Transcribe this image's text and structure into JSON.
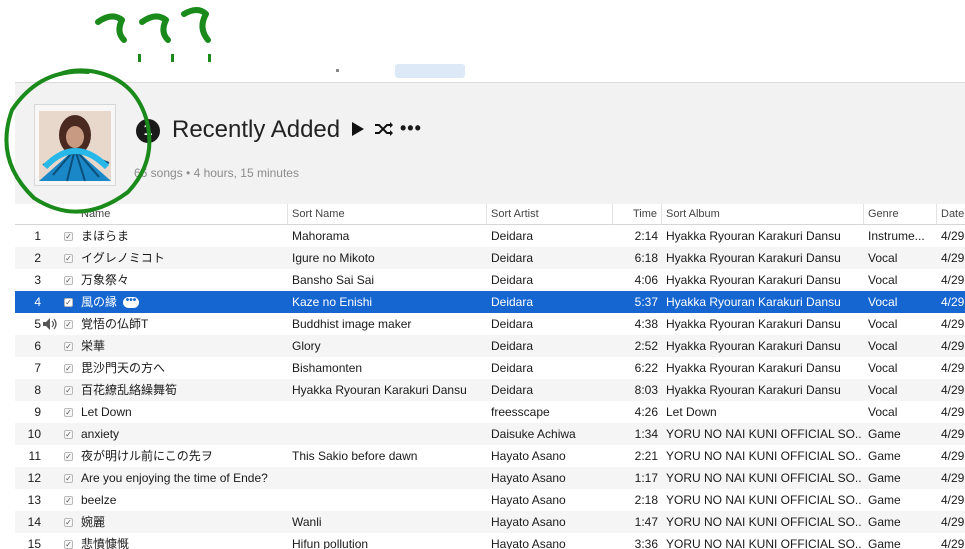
{
  "header": {
    "badge": "1",
    "title": "Recently Added",
    "summary": "66 songs • 4 hours, 15 minutes",
    "more_label": "•••"
  },
  "annotation": {
    "text": "???"
  },
  "columns": {
    "name": "Name",
    "sort_name": "Sort Name",
    "sort_artist": "Sort Artist",
    "time": "Time",
    "sort_album": "Sort Album",
    "genre": "Genre",
    "date": "Date"
  },
  "rows": [
    {
      "num": "1",
      "name": "まほらま",
      "sort_name": "Mahorama",
      "sort_artist": "Deidara",
      "time": "2:14",
      "sort_album": "Hyakka Ryouran Karakuri Dansu",
      "genre": "Instrume...",
      "date": "4/29"
    },
    {
      "num": "2",
      "name": "イグレノミコト",
      "sort_name": "Igure no Mikoto",
      "sort_artist": "Deidara",
      "time": "6:18",
      "sort_album": "Hyakka Ryouran Karakuri Dansu",
      "genre": "Vocal",
      "date": "4/29"
    },
    {
      "num": "3",
      "name": "万象祭々",
      "sort_name": "Bansho Sai Sai",
      "sort_artist": "Deidara",
      "time": "4:06",
      "sort_album": "Hyakka Ryouran Karakuri Dansu",
      "genre": "Vocal",
      "date": "4/29"
    },
    {
      "num": "4",
      "name": "風の縁",
      "sort_name": "Kaze no Enishi",
      "sort_artist": "Deidara",
      "time": "5:37",
      "sort_album": "Hyakka Ryouran Karakuri Dansu",
      "genre": "Vocal",
      "date": "4/29",
      "selected": true
    },
    {
      "num": "5",
      "name": "覚悟の仏師T",
      "sort_name": "Buddhist image maker",
      "sort_artist": "Deidara",
      "time": "4:38",
      "sort_album": "Hyakka Ryouran Karakuri Dansu",
      "genre": "Vocal",
      "date": "4/29",
      "playing": true
    },
    {
      "num": "6",
      "name": "栄華",
      "sort_name": "Glory",
      "sort_artist": "Deidara",
      "time": "2:52",
      "sort_album": "Hyakka Ryouran Karakuri Dansu",
      "genre": "Vocal",
      "date": "4/29"
    },
    {
      "num": "7",
      "name": "毘沙門天の方へ",
      "sort_name": "Bishamonten",
      "sort_artist": "Deidara",
      "time": "6:22",
      "sort_album": "Hyakka Ryouran Karakuri Dansu",
      "genre": "Vocal",
      "date": "4/29"
    },
    {
      "num": "8",
      "name": "百花繚乱絡繰舞筍",
      "sort_name": "Hyakka Ryouran Karakuri Dansu",
      "sort_artist": "Deidara",
      "time": "8:03",
      "sort_album": "Hyakka Ryouran Karakuri Dansu",
      "genre": "Vocal",
      "date": "4/29"
    },
    {
      "num": "9",
      "name": "Let Down",
      "sort_name": "",
      "sort_artist": "freesscape",
      "time": "4:26",
      "sort_album": "Let Down",
      "genre": "Vocal",
      "date": "4/29"
    },
    {
      "num": "10",
      "name": "anxiety",
      "sort_name": "",
      "sort_artist": "Daisuke Achiwa",
      "time": "1:34",
      "sort_album": "YORU NO NAI KUNI OFFICIAL SO...",
      "genre": "Game",
      "date": "4/29"
    },
    {
      "num": "11",
      "name": "夜が明けル前にこの先ヲ",
      "sort_name": "This Sakio before dawn",
      "sort_artist": "Hayato Asano",
      "time": "2:21",
      "sort_album": "YORU NO NAI KUNI OFFICIAL SO...",
      "genre": "Game",
      "date": "4/29"
    },
    {
      "num": "12",
      "name": "Are you enjoying the time of Ende?",
      "sort_name": "",
      "sort_artist": "Hayato Asano",
      "time": "1:17",
      "sort_album": "YORU NO NAI KUNI OFFICIAL SO...",
      "genre": "Game",
      "date": "4/29"
    },
    {
      "num": "13",
      "name": "beelze",
      "sort_name": "",
      "sort_artist": "Hayato Asano",
      "time": "2:18",
      "sort_album": "YORU NO NAI KUNI OFFICIAL SO...",
      "genre": "Game",
      "date": "4/29"
    },
    {
      "num": "14",
      "name": "婉麗",
      "sort_name": "Wanli",
      "sort_artist": "Hayato Asano",
      "time": "1:47",
      "sort_album": "YORU NO NAI KUNI OFFICIAL SO...",
      "genre": "Game",
      "date": "4/29"
    },
    {
      "num": "15",
      "name": "悲憤慷慨",
      "sort_name": "Hifun pollution",
      "sort_artist": "Hayato Asano",
      "time": "3:36",
      "sort_album": "YORU NO NAI KUNI OFFICIAL SO...",
      "genre": "Game",
      "date": "4/29"
    }
  ]
}
